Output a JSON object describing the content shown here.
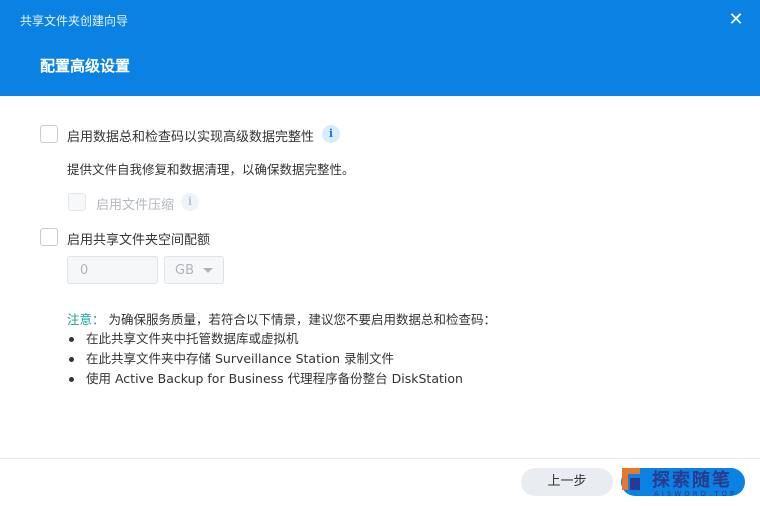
{
  "window": {
    "title": "共享文件夹创建向导",
    "close_icon": "close-icon",
    "step_title": "配置高级设置"
  },
  "options": {
    "checksum": {
      "label": "启用数据总和检查码以实现高级数据完整性",
      "checked": false,
      "description": "提供文件自我修复和数据清理，以确保数据完整性。"
    },
    "compression": {
      "label": "启用文件压缩",
      "checked": false,
      "enabled": false
    },
    "quota": {
      "label": "启用共享文件夹空间配额",
      "checked": false,
      "value": "0",
      "unit": "GB"
    }
  },
  "note": {
    "prefix": "注意：",
    "text": "为确保服务质量，若符合以下情景，建议您不要启用数据总和检查码：",
    "items": [
      "在此共享文件夹中托管数据库或虚拟机",
      "在此共享文件夹中存储 Surveillance Station 录制文件",
      "使用 Active Backup for Business 代理程序备份整台 DiskStation"
    ]
  },
  "footer": {
    "prev_label": "上一步"
  },
  "watermark": {
    "text": "探索随笔",
    "sub": "AISWORD.TOP"
  },
  "colors": {
    "header": "#0a82e4",
    "accent": "#0a82e4",
    "note_prefix": "#1aa39a"
  }
}
